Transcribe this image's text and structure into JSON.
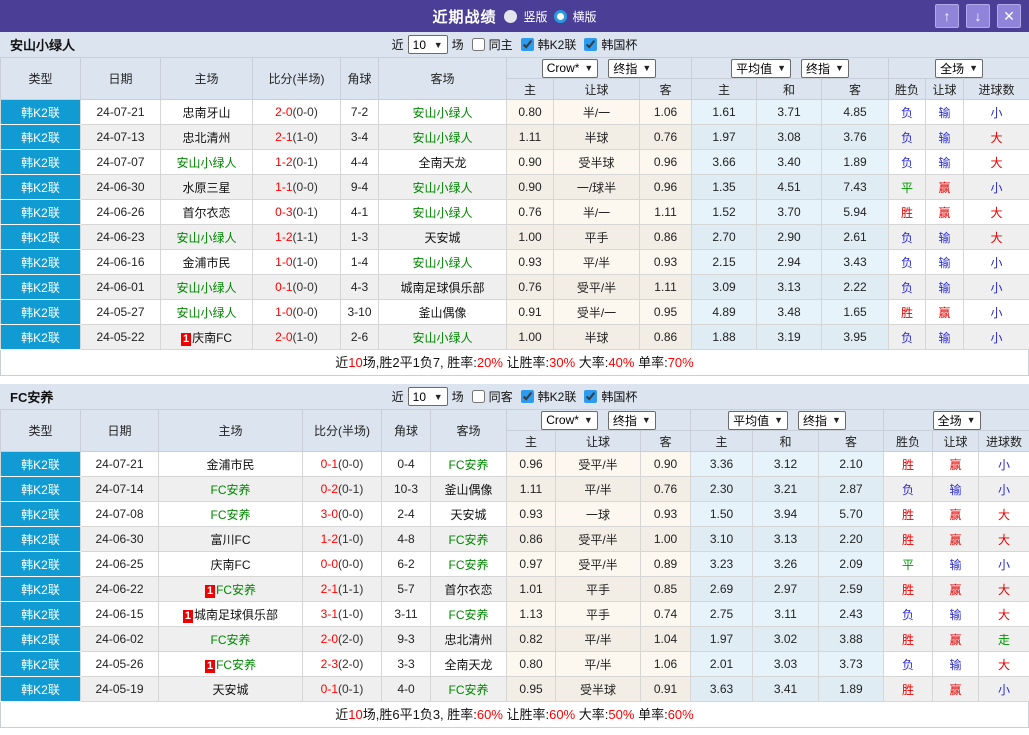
{
  "title_bar": {
    "title": "近期战绩",
    "vertical_label": "竖版",
    "horizontal_label": "横版",
    "selected_mode": "横版",
    "up_icon": "↑",
    "down_icon": "↓",
    "close_icon": "✕"
  },
  "table_header": {
    "type": "类型",
    "date": "日期",
    "home": "主场",
    "score": "比分(半场)",
    "corner": "角球",
    "away": "客场",
    "asian_bookmaker_select": "Crow*",
    "asian_final_select": "终指",
    "asian_sub": {
      "home": "主",
      "handicap": "让球",
      "away": "客"
    },
    "euro_avg_select": "平均值",
    "euro_final_select": "终指",
    "euro_sub": {
      "home": "主",
      "draw": "和",
      "away": "客"
    },
    "fullmatch_select": "全场",
    "result_sub": {
      "outcome": "胜负",
      "handicap": "让球",
      "goals": "进球数"
    }
  },
  "colors": {
    "title_bar_bg": "#4b3e97",
    "window_button_bg": "#8f84da",
    "type_cell_bg": "#119bd3",
    "header_bg": "#dce5ef",
    "row_alt_bg": "#efefef",
    "asian_col_bg": "#fdf8ef",
    "euro_col_bg": "#e7f3fa",
    "team_highlight_green": "#008800",
    "score_red": "#ff0000",
    "result_red": "#e60000",
    "result_blue": "#2b2bd0",
    "result_green": "#009900",
    "checkbox_blue": "#2d9bf0",
    "result_map": {
      "胜": "red",
      "负": "blue",
      "平": "green",
      "赢": "red",
      "输": "blue",
      "大": "red",
      "小": "blue",
      "走": "green"
    }
  },
  "sections": [
    {
      "team": "安山小绿人",
      "filter": {
        "near_label": "近",
        "match_count": "10",
        "games_label": "场",
        "same_label": "同主",
        "same_checked": false,
        "league1_label": "韩K2联",
        "league1_checked": true,
        "league2_label": "韩国杯",
        "league2_checked": true
      },
      "rows": [
        {
          "lg": "韩K2联",
          "date": "24-07-21",
          "home": {
            "name": "忠南牙山",
            "green": false,
            "badge": null
          },
          "score": "2-0",
          "half": "(0-0)",
          "corner": "7-2",
          "away": {
            "name": "安山小绿人",
            "green": true,
            "badge": null
          },
          "ah": [
            "0.80",
            "半/一",
            "1.06"
          ],
          "eu": [
            "1.61",
            "3.71",
            "4.85"
          ],
          "res": [
            "负",
            "输",
            "小"
          ]
        },
        {
          "lg": "韩K2联",
          "date": "24-07-13",
          "home": {
            "name": "忠北清州",
            "green": false,
            "badge": null
          },
          "score": "2-1",
          "half": "(1-0)",
          "corner": "3-4",
          "away": {
            "name": "安山小绿人",
            "green": true,
            "badge": null
          },
          "ah": [
            "1.11",
            "半球",
            "0.76"
          ],
          "eu": [
            "1.97",
            "3.08",
            "3.76"
          ],
          "res": [
            "负",
            "输",
            "大"
          ]
        },
        {
          "lg": "韩K2联",
          "date": "24-07-07",
          "home": {
            "name": "安山小绿人",
            "green": true,
            "badge": null
          },
          "score": "1-2",
          "half": "(0-1)",
          "corner": "4-4",
          "away": {
            "name": "全南天龙",
            "green": false,
            "badge": null
          },
          "ah": [
            "0.90",
            "受半球",
            "0.96"
          ],
          "eu": [
            "3.66",
            "3.40",
            "1.89"
          ],
          "res": [
            "负",
            "输",
            "大"
          ]
        },
        {
          "lg": "韩K2联",
          "date": "24-06-30",
          "home": {
            "name": "水原三星",
            "green": false,
            "badge": null
          },
          "score": "1-1",
          "half": "(0-0)",
          "corner": "9-4",
          "away": {
            "name": "安山小绿人",
            "green": true,
            "badge": null
          },
          "ah": [
            "0.90",
            "一/球半",
            "0.96"
          ],
          "eu": [
            "1.35",
            "4.51",
            "7.43"
          ],
          "res": [
            "平",
            "赢",
            "小"
          ]
        },
        {
          "lg": "韩K2联",
          "date": "24-06-26",
          "home": {
            "name": "首尔衣恋",
            "green": false,
            "badge": null
          },
          "score": "0-3",
          "half": "(0-1)",
          "corner": "4-1",
          "away": {
            "name": "安山小绿人",
            "green": true,
            "badge": null
          },
          "ah": [
            "0.76",
            "半/一",
            "1.11"
          ],
          "eu": [
            "1.52",
            "3.70",
            "5.94"
          ],
          "res": [
            "胜",
            "赢",
            "大"
          ]
        },
        {
          "lg": "韩K2联",
          "date": "24-06-23",
          "home": {
            "name": "安山小绿人",
            "green": true,
            "badge": null
          },
          "score": "1-2",
          "half": "(1-1)",
          "corner": "1-3",
          "away": {
            "name": "天安城",
            "green": false,
            "badge": null
          },
          "ah": [
            "1.00",
            "平手",
            "0.86"
          ],
          "eu": [
            "2.70",
            "2.90",
            "2.61"
          ],
          "res": [
            "负",
            "输",
            "大"
          ]
        },
        {
          "lg": "韩K2联",
          "date": "24-06-16",
          "home": {
            "name": "金浦市民",
            "green": false,
            "badge": null
          },
          "score": "1-0",
          "half": "(1-0)",
          "corner": "1-4",
          "away": {
            "name": "安山小绿人",
            "green": true,
            "badge": null
          },
          "ah": [
            "0.93",
            "平/半",
            "0.93"
          ],
          "eu": [
            "2.15",
            "2.94",
            "3.43"
          ],
          "res": [
            "负",
            "输",
            "小"
          ]
        },
        {
          "lg": "韩K2联",
          "date": "24-06-01",
          "home": {
            "name": "安山小绿人",
            "green": true,
            "badge": null
          },
          "score": "0-1",
          "half": "(0-0)",
          "corner": "4-3",
          "away": {
            "name": "城南足球俱乐部",
            "green": false,
            "badge": null
          },
          "ah": [
            "0.76",
            "受平/半",
            "1.11"
          ],
          "eu": [
            "3.09",
            "3.13",
            "2.22"
          ],
          "res": [
            "负",
            "输",
            "小"
          ]
        },
        {
          "lg": "韩K2联",
          "date": "24-05-27",
          "home": {
            "name": "安山小绿人",
            "green": true,
            "badge": null
          },
          "score": "1-0",
          "half": "(0-0)",
          "corner": "3-10",
          "away": {
            "name": "釜山偶像",
            "green": false,
            "badge": null
          },
          "ah": [
            "0.91",
            "受半/一",
            "0.95"
          ],
          "eu": [
            "4.89",
            "3.48",
            "1.65"
          ],
          "res": [
            "胜",
            "赢",
            "小"
          ]
        },
        {
          "lg": "韩K2联",
          "date": "24-05-22",
          "home": {
            "name": "庆南FC",
            "green": false,
            "badge": "1"
          },
          "score": "2-0",
          "half": "(1-0)",
          "corner": "2-6",
          "away": {
            "name": "安山小绿人",
            "green": true,
            "badge": null
          },
          "ah": [
            "1.00",
            "半球",
            "0.86"
          ],
          "eu": [
            "1.88",
            "3.19",
            "3.95"
          ],
          "res": [
            "负",
            "输",
            "小"
          ]
        }
      ],
      "summary_parts": [
        [
          "近",
          "k"
        ],
        [
          "10",
          "r"
        ],
        [
          "场,胜2平1负7, 胜率:",
          "k"
        ],
        [
          "20%",
          "r"
        ],
        [
          " 让胜率:",
          "k"
        ],
        [
          "30%",
          "r"
        ],
        [
          " 大率:",
          "k"
        ],
        [
          "40%",
          "r"
        ],
        [
          " 单率:",
          "k"
        ],
        [
          "70%",
          "r"
        ]
      ]
    },
    {
      "team": "FC安养",
      "filter": {
        "near_label": "近",
        "match_count": "10",
        "games_label": "场",
        "same_label": "同客",
        "same_checked": false,
        "league1_label": "韩K2联",
        "league1_checked": true,
        "league2_label": "韩国杯",
        "league2_checked": true
      },
      "rows": [
        {
          "lg": "韩K2联",
          "date": "24-07-21",
          "home": {
            "name": "金浦市民",
            "green": false,
            "badge": null
          },
          "score": "0-1",
          "half": "(0-0)",
          "corner": "0-4",
          "away": {
            "name": "FC安养",
            "green": true,
            "badge": null
          },
          "ah": [
            "0.96",
            "受平/半",
            "0.90"
          ],
          "eu": [
            "3.36",
            "3.12",
            "2.10"
          ],
          "res": [
            "胜",
            "赢",
            "小"
          ]
        },
        {
          "lg": "韩K2联",
          "date": "24-07-14",
          "home": {
            "name": "FC安养",
            "green": true,
            "badge": null
          },
          "score": "0-2",
          "half": "(0-1)",
          "corner": "10-3",
          "away": {
            "name": "釜山偶像",
            "green": false,
            "badge": null
          },
          "ah": [
            "1.11",
            "平/半",
            "0.76"
          ],
          "eu": [
            "2.30",
            "3.21",
            "2.87"
          ],
          "res": [
            "负",
            "输",
            "小"
          ]
        },
        {
          "lg": "韩K2联",
          "date": "24-07-08",
          "home": {
            "name": "FC安养",
            "green": true,
            "badge": null
          },
          "score": "3-0",
          "half": "(0-0)",
          "corner": "2-4",
          "away": {
            "name": "天安城",
            "green": false,
            "badge": null
          },
          "ah": [
            "0.93",
            "一球",
            "0.93"
          ],
          "eu": [
            "1.50",
            "3.94",
            "5.70"
          ],
          "res": [
            "胜",
            "赢",
            "大"
          ]
        },
        {
          "lg": "韩K2联",
          "date": "24-06-30",
          "home": {
            "name": "富川FC",
            "green": false,
            "badge": null
          },
          "score": "1-2",
          "half": "(1-0)",
          "corner": "4-8",
          "away": {
            "name": "FC安养",
            "green": true,
            "badge": null
          },
          "ah": [
            "0.86",
            "受平/半",
            "1.00"
          ],
          "eu": [
            "3.10",
            "3.13",
            "2.20"
          ],
          "res": [
            "胜",
            "赢",
            "大"
          ]
        },
        {
          "lg": "韩K2联",
          "date": "24-06-25",
          "home": {
            "name": "庆南FC",
            "green": false,
            "badge": null
          },
          "score": "0-0",
          "half": "(0-0)",
          "corner": "6-2",
          "away": {
            "name": "FC安养",
            "green": true,
            "badge": null
          },
          "ah": [
            "0.97",
            "受平/半",
            "0.89"
          ],
          "eu": [
            "3.23",
            "3.26",
            "2.09"
          ],
          "res": [
            "平",
            "输",
            "小"
          ]
        },
        {
          "lg": "韩K2联",
          "date": "24-06-22",
          "home": {
            "name": "FC安养",
            "green": true,
            "badge": "1"
          },
          "score": "2-1",
          "half": "(1-1)",
          "corner": "5-7",
          "away": {
            "name": "首尔衣恋",
            "green": false,
            "badge": null
          },
          "ah": [
            "1.01",
            "平手",
            "0.85"
          ],
          "eu": [
            "2.69",
            "2.97",
            "2.59"
          ],
          "res": [
            "胜",
            "赢",
            "大"
          ]
        },
        {
          "lg": "韩K2联",
          "date": "24-06-15",
          "home": {
            "name": "城南足球俱乐部",
            "green": false,
            "badge": "1"
          },
          "score": "3-1",
          "half": "(1-0)",
          "corner": "3-11",
          "away": {
            "name": "FC安养",
            "green": true,
            "badge": null
          },
          "ah": [
            "1.13",
            "平手",
            "0.74"
          ],
          "eu": [
            "2.75",
            "3.11",
            "2.43"
          ],
          "res": [
            "负",
            "输",
            "大"
          ]
        },
        {
          "lg": "韩K2联",
          "date": "24-06-02",
          "home": {
            "name": "FC安养",
            "green": true,
            "badge": null
          },
          "score": "2-0",
          "half": "(2-0)",
          "corner": "9-3",
          "away": {
            "name": "忠北清州",
            "green": false,
            "badge": null
          },
          "ah": [
            "0.82",
            "平/半",
            "1.04"
          ],
          "eu": [
            "1.97",
            "3.02",
            "3.88"
          ],
          "res": [
            "胜",
            "赢",
            "走"
          ]
        },
        {
          "lg": "韩K2联",
          "date": "24-05-26",
          "home": {
            "name": "FC安养",
            "green": true,
            "badge": "1"
          },
          "score": "2-3",
          "half": "(2-0)",
          "corner": "3-3",
          "away": {
            "name": "全南天龙",
            "green": false,
            "badge": null
          },
          "ah": [
            "0.80",
            "平/半",
            "1.06"
          ],
          "eu": [
            "2.01",
            "3.03",
            "3.73"
          ],
          "res": [
            "负",
            "输",
            "大"
          ]
        },
        {
          "lg": "韩K2联",
          "date": "24-05-19",
          "home": {
            "name": "天安城",
            "green": false,
            "badge": null
          },
          "score": "0-1",
          "half": "(0-1)",
          "corner": "4-0",
          "away": {
            "name": "FC安养",
            "green": true,
            "badge": null
          },
          "ah": [
            "0.95",
            "受半球",
            "0.91"
          ],
          "eu": [
            "3.63",
            "3.41",
            "1.89"
          ],
          "res": [
            "胜",
            "赢",
            "小"
          ]
        }
      ],
      "summary_parts": [
        [
          "近",
          "k"
        ],
        [
          "10",
          "r"
        ],
        [
          "场,胜6平1负3, 胜率:",
          "k"
        ],
        [
          "60%",
          "r"
        ],
        [
          " 让胜率:",
          "k"
        ],
        [
          "60%",
          "r"
        ],
        [
          " 大率:",
          "k"
        ],
        [
          "50%",
          "r"
        ],
        [
          " 单率:",
          "k"
        ],
        [
          "60%",
          "r"
        ]
      ]
    }
  ]
}
